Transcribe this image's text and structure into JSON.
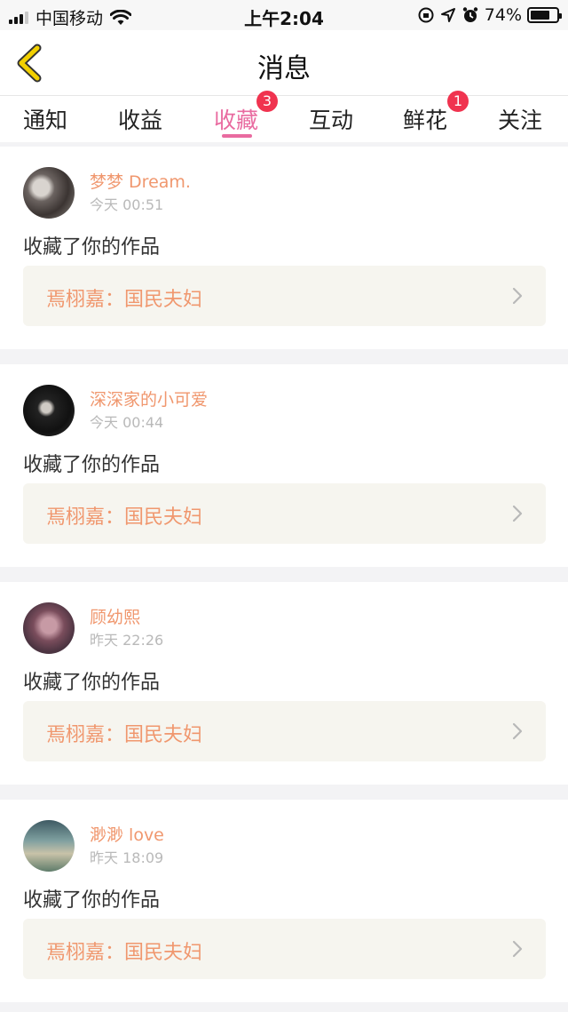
{
  "status_bar": {
    "carrier": "中国移动",
    "time": "上午2:04",
    "battery_percent": "74%",
    "battery_level": 0.74
  },
  "nav": {
    "title": "消息"
  },
  "tabs": [
    {
      "label": "通知",
      "active": false
    },
    {
      "label": "收益",
      "active": false
    },
    {
      "label": "收藏",
      "active": true,
      "badge": "3"
    },
    {
      "label": "互动",
      "active": false
    },
    {
      "label": "鲜花",
      "active": false,
      "badge": "1"
    },
    {
      "label": "关注",
      "active": false
    }
  ],
  "messages": [
    {
      "user": "梦梦 Dream.",
      "time": "今天 00:51",
      "action": "收藏了你的作品",
      "work": "焉栩嘉：国民夫妇",
      "avatar_icon": "user-avatar-photo"
    },
    {
      "user": "深深家的小可爱",
      "time": "今天 00:44",
      "action": "收藏了你的作品",
      "work": "焉栩嘉：国民夫妇",
      "avatar_icon": "user-avatar-photo"
    },
    {
      "user": "顾幼熙",
      "time": "昨天 22:26",
      "action": "收藏了你的作品",
      "work": "焉栩嘉：国民夫妇",
      "avatar_icon": "user-avatar-photo"
    },
    {
      "user": "渺渺 love",
      "time": "昨天 18:09",
      "action": "收藏了你的作品",
      "work": "焉栩嘉：国民夫妇",
      "avatar_icon": "user-avatar-photo"
    }
  ],
  "colors": {
    "accent": "#e96ba0",
    "username": "#f0976e",
    "badge": "#f0334f",
    "work_bg": "#f6f5ef",
    "back_arrow": "#f2d000"
  }
}
